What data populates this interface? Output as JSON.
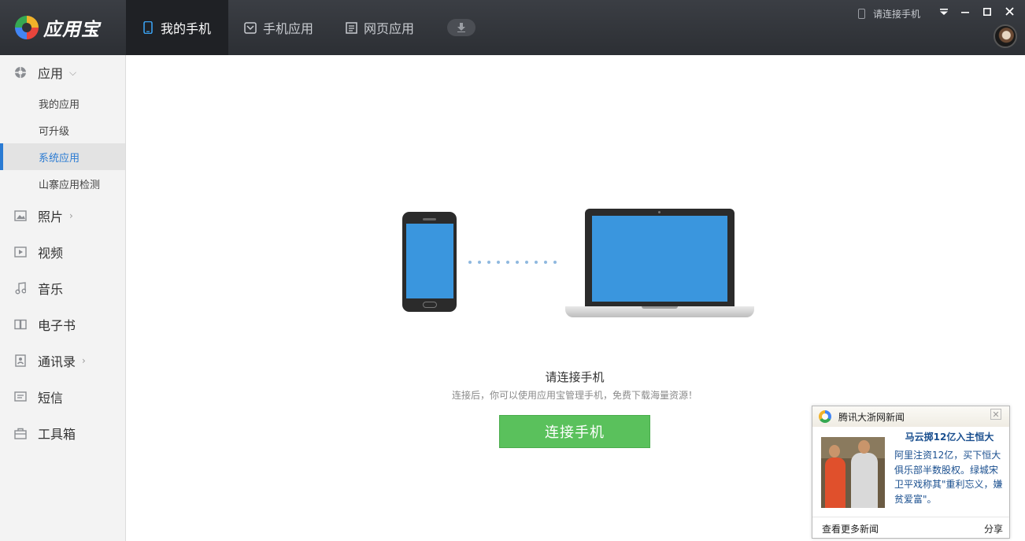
{
  "app": {
    "name": "应用宝"
  },
  "tabs": [
    {
      "label": "我的手机",
      "icon": "phone-icon",
      "active": true
    },
    {
      "label": "手机应用",
      "icon": "app-store-icon",
      "active": false
    },
    {
      "label": "网页应用",
      "icon": "web-app-icon",
      "active": false
    }
  ],
  "titlebar": {
    "connect_hint": "请连接手机",
    "download_icon": "download-icon",
    "menu_icon": "dropdown-menu-icon",
    "minimize_icon": "minimize-icon",
    "maximize_icon": "maximize-icon",
    "close_icon": "close-icon"
  },
  "sidebar": {
    "items": [
      {
        "label": "应用",
        "icon": "apps-icon",
        "expanded": true,
        "children": [
          "我的应用",
          "可升级",
          "系统应用",
          "山寨应用检测"
        ],
        "active_child": "系统应用"
      },
      {
        "label": "照片",
        "icon": "photo-icon"
      },
      {
        "label": "视频",
        "icon": "video-icon"
      },
      {
        "label": "音乐",
        "icon": "music-icon"
      },
      {
        "label": "电子书",
        "icon": "ebook-icon"
      },
      {
        "label": "通讯录",
        "icon": "contacts-icon"
      },
      {
        "label": "短信",
        "icon": "sms-icon"
      },
      {
        "label": "工具箱",
        "icon": "toolbox-icon"
      }
    ]
  },
  "main": {
    "title": "请连接手机",
    "subtitle": "连接后，你可以使用应用宝管理手机，免费下载海量资源！",
    "button": "连接手机"
  },
  "news_popup": {
    "source": "腾讯大浙网新闻",
    "headline": "马云掷12亿入主恒大",
    "body": "阿里注资12亿，买下恒大俱乐部半数股权。绿城宋卫平戏称其\"重利忘义，嫌贫爱富\"。",
    "more": "查看更多新闻",
    "share": "分享"
  },
  "colors": {
    "accent": "#2a7bd3",
    "topbar": "#2f3237",
    "button": "#5ac15c",
    "screen": "#3a96de"
  }
}
